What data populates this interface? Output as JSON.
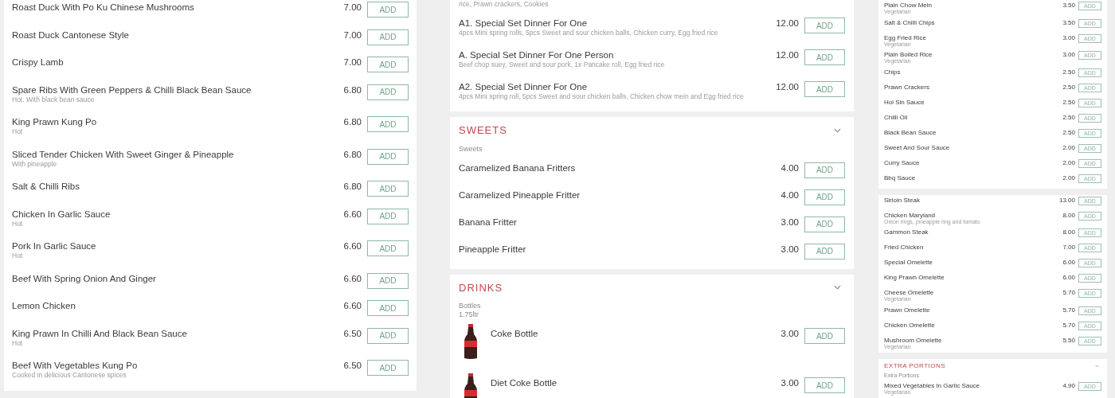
{
  "columns": [
    {
      "sections": [
        {
          "items": [
            {
              "name": "Roast Duck With Po Ku Chinese Mushrooms",
              "price": "7.00",
              "button": "ADD"
            },
            {
              "name": "Roast Duck Cantonese Style",
              "price": "7.00",
              "button": "ADD"
            },
            {
              "name": "Crispy Lamb",
              "price": "7.00",
              "button": "ADD"
            },
            {
              "name": "Spare Ribs With Green Peppers & Chilli Black Bean Sauce",
              "description": "Hot. With black bean sauce",
              "price": "6.80",
              "button": "ADD"
            },
            {
              "name": "King Prawn Kung Po",
              "description": "Hot",
              "price": "6.80",
              "button": "ADD"
            },
            {
              "name": "Sliced Tender Chicken With Sweet Ginger & Pineapple",
              "description": "With pineapple",
              "price": "6.80",
              "button": "ADD"
            },
            {
              "name": "Salt & Chilli Ribs",
              "price": "6.80",
              "button": "ADD"
            },
            {
              "name": "Chicken In Garlic Sauce",
              "description": "Hot",
              "price": "6.60",
              "button": "ADD"
            },
            {
              "name": "Pork In Garlic Sauce",
              "description": "Hot",
              "price": "6.60",
              "button": "ADD"
            },
            {
              "name": "Beef With Spring Onion And Ginger",
              "price": "6.60",
              "button": "ADD"
            },
            {
              "name": "Lemon Chicken",
              "price": "6.60",
              "button": "ADD"
            },
            {
              "name": "King Prawn In Chilli And Black Bean Sauce",
              "description": "Hot",
              "price": "6.50",
              "button": "ADD"
            },
            {
              "name": "Beef With Vegetables Kung Po",
              "description": "Cooked in delicious Cantonese spices",
              "price": "6.50",
              "button": "ADD"
            }
          ]
        }
      ]
    },
    {
      "sections": [
        {
          "continued_text": "rice, Prawn crackers, Cookies",
          "items": [
            {
              "name": "A1. Special Set Dinner For One",
              "description": "4pcs Mini spring rolls, 5pcs Sweet and sour chicken balls, Chicken curry, Egg fried rice",
              "price": "12.00",
              "button": "ADD"
            },
            {
              "name": "A. Special Set Dinner For One Person",
              "description": "Beef chop suey, Sweet and sour pork, 1x Pancake roll, Egg fried rice",
              "price": "12.00",
              "button": "ADD"
            },
            {
              "name": "A2. Special Set Dinner For One",
              "description": "4pcs Mini spring roll, 5pcs Sweet and sour chicken balls, Chicken chow mein and Egg fried rice",
              "price": "12.00",
              "button": "ADD"
            }
          ]
        },
        {
          "title": "SWEETS",
          "expanded": true,
          "subtitle_lines": [
            "Sweets"
          ],
          "items": [
            {
              "name": "Caramelized Banana Fritters",
              "price": "4.00",
              "button": "ADD"
            },
            {
              "name": "Caramelized Pineapple Fritter",
              "price": "4.00",
              "button": "ADD"
            },
            {
              "name": "Banana Fritter",
              "price": "3.00",
              "button": "ADD"
            },
            {
              "name": "Pineapple Fritter",
              "price": "3.00",
              "button": "ADD"
            }
          ]
        },
        {
          "title": "DRINKS",
          "expanded": true,
          "subtitle_lines": [
            "Bottles",
            "1.75ltr"
          ],
          "items": [
            {
              "name": "Coke Bottle",
              "price": "3.00",
              "button": "ADD",
              "photo": true
            },
            {
              "name": "Diet Coke Bottle",
              "price": "3.00",
              "button": "ADD",
              "photo": true
            }
          ]
        }
      ]
    },
    {
      "sections": [
        {
          "items": [
            {
              "name": "Plain Chow Mein",
              "description": "Vegetarian",
              "price": "3.50",
              "button": "ADD"
            },
            {
              "name": "Salt & Chilli Chips",
              "price": "3.50",
              "button": "ADD"
            },
            {
              "name": "Egg Fried Rice",
              "description": "Vegetarian",
              "price": "3.00",
              "button": "ADD"
            },
            {
              "name": "Plain Boiled Rice",
              "description": "Vegetarian",
              "price": "3.00",
              "button": "ADD"
            },
            {
              "name": "Chips",
              "price": "2.50",
              "button": "ADD"
            },
            {
              "name": "Prawn Crackers",
              "price": "2.50",
              "button": "ADD"
            },
            {
              "name": "Hoi Sin Sauce",
              "price": "2.50",
              "button": "ADD"
            },
            {
              "name": "Chilli Oil",
              "price": "2.50",
              "button": "ADD"
            },
            {
              "name": "Black Bean Sauce",
              "price": "2.50",
              "button": "ADD"
            },
            {
              "name": "Sweet And Sour Sauce",
              "price": "2.00",
              "button": "ADD"
            },
            {
              "name": "Curry Sauce",
              "price": "2.00",
              "button": "ADD"
            },
            {
              "name": "Bbq Sauce",
              "price": "2.00",
              "button": "ADD"
            }
          ]
        },
        {
          "items": [
            {
              "name": "Sirloin Steak",
              "price": "13.00",
              "button": "ADD"
            },
            {
              "name": "Chicken Maryland",
              "description": "Onion rings, pineapple ring and tomato",
              "price": "8.00",
              "button": "ADD"
            },
            {
              "name": "Gammon Steak",
              "price": "8.00",
              "button": "ADD"
            },
            {
              "name": "Fried Chicken",
              "price": "7.00",
              "button": "ADD"
            },
            {
              "name": "Special Omelette",
              "price": "6.00",
              "button": "ADD"
            },
            {
              "name": "King Prawn Omelette",
              "price": "6.00",
              "button": "ADD"
            },
            {
              "name": "Cheese Omelette",
              "description": "Vegetarian",
              "price": "5.70",
              "button": "ADD"
            },
            {
              "name": "Prawn Omelette",
              "price": "5.70",
              "button": "ADD"
            },
            {
              "name": "Chicken Omelette",
              "price": "5.70",
              "button": "ADD"
            },
            {
              "name": "Mushroom Omelette",
              "description": "Vegetarian",
              "price": "5.50",
              "button": "ADD"
            }
          ]
        },
        {
          "title": "EXTRA PORTIONS",
          "expanded": true,
          "subtitle_lines": [
            "Extra Portions"
          ],
          "items": [
            {
              "name": "Mixed Vegetables In Garlic Sauce",
              "description": "Vegetarian",
              "price": "4.90",
              "button": "ADD"
            }
          ]
        }
      ]
    }
  ]
}
